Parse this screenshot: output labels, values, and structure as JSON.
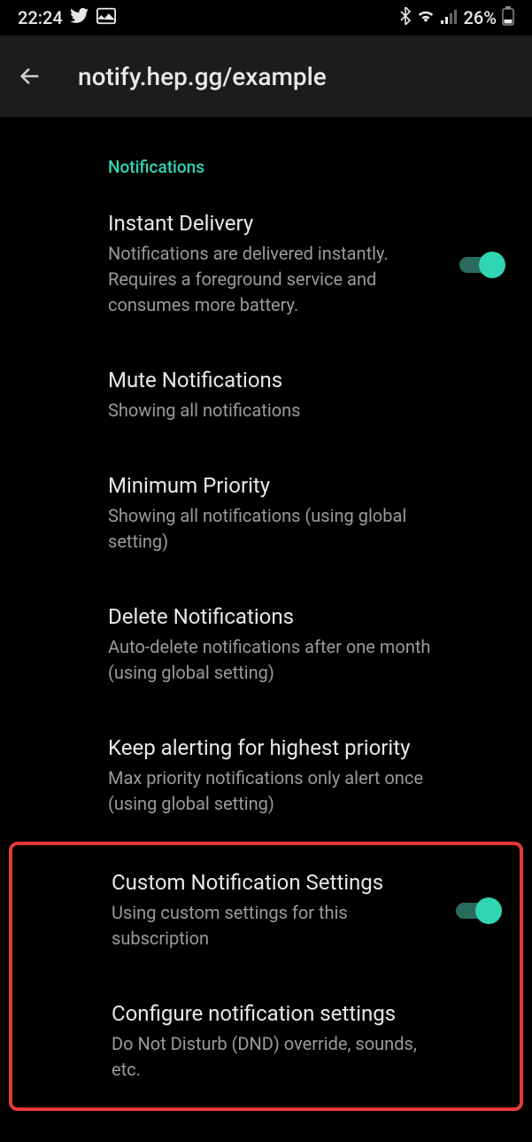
{
  "status_bar": {
    "time": "22:24",
    "battery_pct": "26%"
  },
  "app_bar": {
    "title": "notify.hep.gg/example"
  },
  "section": {
    "header": "Notifications"
  },
  "settings": {
    "instant_delivery": {
      "title": "Instant Delivery",
      "subtitle": "Notifications are delivered instantly. Requires a foreground service and consumes more battery."
    },
    "mute": {
      "title": "Mute Notifications",
      "subtitle": "Showing all notifications"
    },
    "min_priority": {
      "title": "Minimum Priority",
      "subtitle": "Showing all notifications (using global setting)"
    },
    "delete": {
      "title": "Delete Notifications",
      "subtitle": "Auto-delete notifications after one month (using global setting)"
    },
    "keep_alerting": {
      "title": "Keep alerting for highest priority",
      "subtitle": "Max priority notifications only alert once (using global setting)"
    },
    "custom": {
      "title": "Custom Notification Settings",
      "subtitle": "Using custom settings for this subscription"
    },
    "configure": {
      "title": "Configure notification settings",
      "subtitle": "Do Not Disturb (DND) override, sounds, etc."
    }
  }
}
